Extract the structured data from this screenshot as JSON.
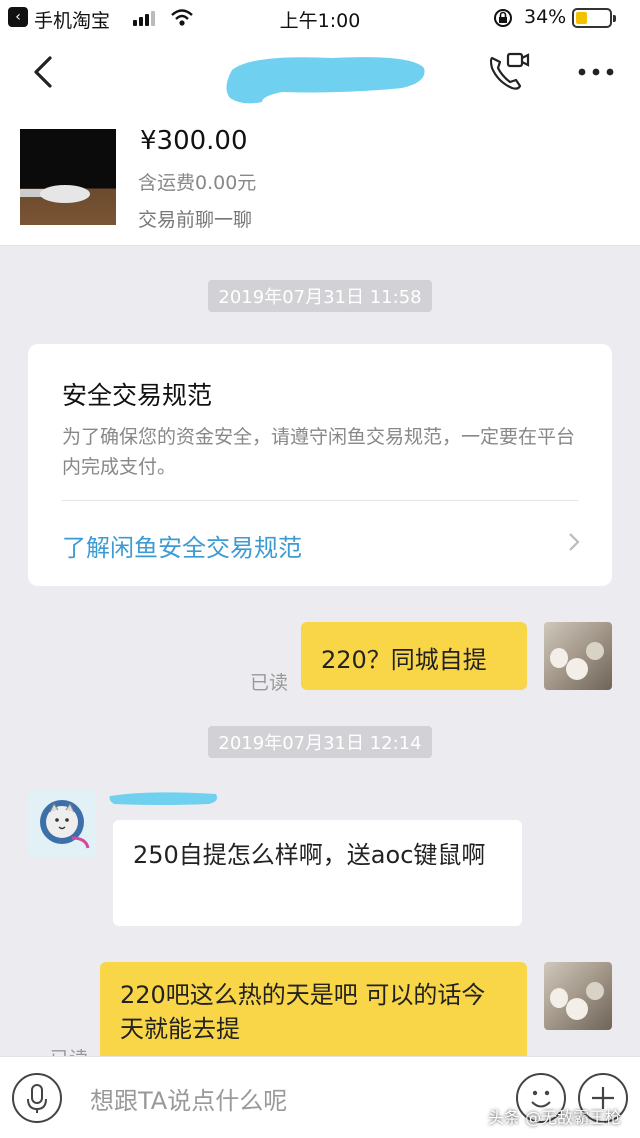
{
  "status_bar": {
    "back_app": "手机淘宝",
    "time": "上午1:00",
    "battery_percent": "34%",
    "battery_level": 0.34
  },
  "product": {
    "price": "¥300.00",
    "shipping": "含运费0.00元",
    "chat_hint": "交易前聊一聊"
  },
  "timestamps": [
    "2019年07月31日 11:58",
    "2019年07月31日 12:14"
  ],
  "safety_card": {
    "title": "安全交易规范",
    "description": "为了确保您的资金安全，请遵守闲鱼交易规范，一定要在平台内完成支付。",
    "link": "了解闲鱼安全交易规范"
  },
  "messages": [
    {
      "from": "me",
      "text": "220？同城自提",
      "status": "已读"
    },
    {
      "from": "other",
      "text": "250自提怎么样啊，送aoc键鼠啊"
    },
    {
      "from": "me",
      "text": "220吧这么热的天是吧 可以的话今天就能去提",
      "status": "已读"
    }
  ],
  "input": {
    "placeholder": "想跟TA说点什么呢"
  },
  "watermark": "头条 @无敌霸王枪",
  "colors": {
    "outgoing_bubble": "#f9d648",
    "link": "#3c9bd3",
    "redaction": "#6fd0f0"
  }
}
